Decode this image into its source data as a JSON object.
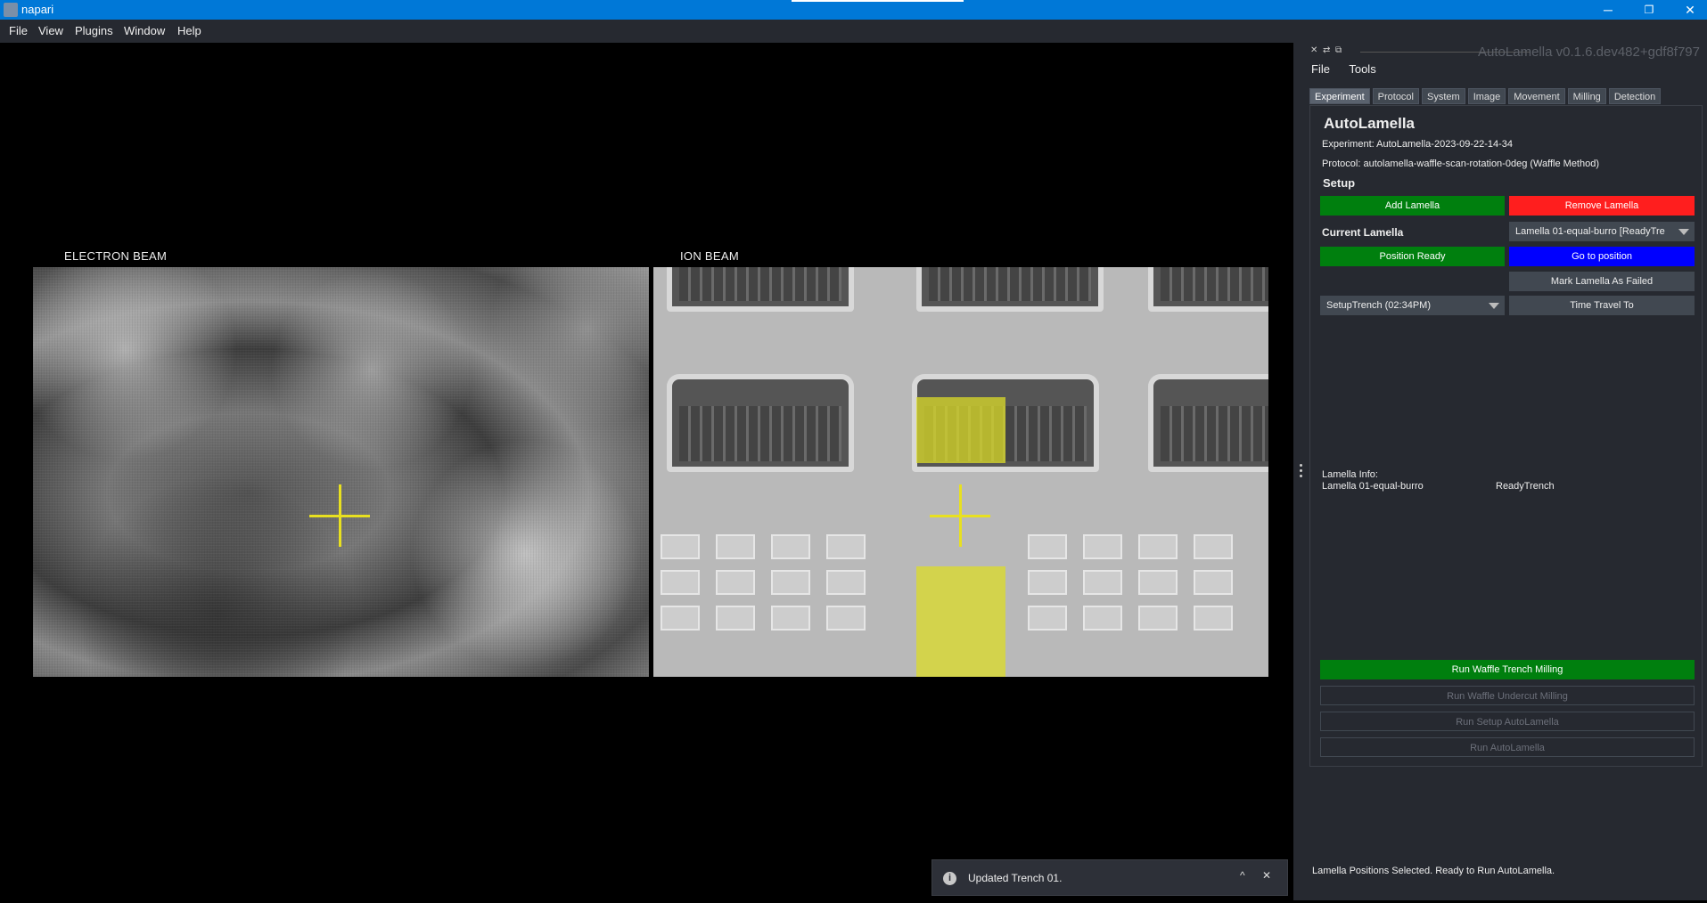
{
  "window": {
    "title": "napari",
    "minimize": "─",
    "restore": "❐",
    "close": "✕"
  },
  "menubar": [
    "File",
    "View",
    "Plugins",
    "Window",
    "Help"
  ],
  "viewer": {
    "electron_label": "ELECTRON BEAM",
    "ion_label": "ION BEAM"
  },
  "dock": {
    "title": "AutoLamella v0.1.6.dev482+gdf8f797",
    "close_glyph": "✕",
    "float_glyph": "⇄",
    "search_glyph": "⧉",
    "menu": [
      "File",
      "Tools"
    ],
    "tabs": [
      "Experiment",
      "Protocol",
      "System",
      "Image",
      "Movement",
      "Milling",
      "Detection"
    ],
    "active_tab": "Experiment"
  },
  "panel": {
    "heading": "AutoLamella",
    "experiment": "Experiment: AutoLamella-2023-09-22-14-34",
    "protocol": "Protocol: autolamella-waffle-scan-rotation-0deg (Waffle Method)",
    "setup_heading": "Setup",
    "add_lamella": "Add Lamella",
    "remove_lamella": "Remove Lamella",
    "current_lamella_label": "Current Lamella",
    "current_lamella_value": "Lamella 01-equal-burro [ReadyTre",
    "position_ready": "Position Ready",
    "go_to_position": "Go to position",
    "mark_failed": "Mark Lamella As Failed",
    "time_travel_value": "SetupTrench (02:34PM)",
    "time_travel_to": "Time Travel To",
    "info_label": "Lamella Info:",
    "info_name": "Lamella 01-equal-burro",
    "info_state": "ReadyTrench",
    "run_trench": "Run Waffle Trench Milling",
    "run_undercut": "Run Waffle Undercut Milling",
    "run_setup": "Run Setup AutoLamella",
    "run_autolamella": "Run AutoLamella",
    "status": "Lamella Positions Selected. Ready to Run AutoLamella."
  },
  "toast": {
    "icon": "i",
    "message": "Updated Trench 01.",
    "expand": "^",
    "dismiss": "✕"
  },
  "colors": {
    "titlebar": "#0078d7",
    "background": "#262930",
    "accent_green": "#007f0e",
    "accent_red": "#ff1e1e",
    "accent_blue": "#0000ff",
    "overlay_yellow": "#e8e020"
  }
}
